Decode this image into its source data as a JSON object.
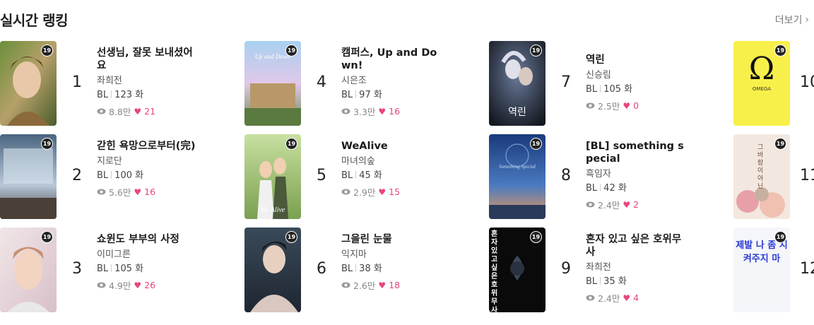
{
  "header": {
    "title": "실시간 랭킹",
    "more_label": "더보기"
  },
  "age_badge": "19",
  "ranking": [
    {
      "rank": "1",
      "title": "선생님, 잘못 보내셨어요",
      "author": "좌희전",
      "genre": "BL",
      "episodes": "123 화",
      "views": "8.8만",
      "likes": "21"
    },
    {
      "rank": "2",
      "title": "갇힌 욕망으로부터(完)",
      "author": "지로단",
      "genre": "BL",
      "episodes": "100 화",
      "views": "5.6만",
      "likes": "16"
    },
    {
      "rank": "3",
      "title": "쇼윈도 부부의 사정",
      "author": "이미그른",
      "genre": "BL",
      "episodes": "105 화",
      "views": "4.9만",
      "likes": "26"
    },
    {
      "rank": "4",
      "title": "캠퍼스, Up and Down!",
      "author": "시은조",
      "genre": "BL",
      "episodes": "97 화",
      "views": "3.3만",
      "likes": "16"
    },
    {
      "rank": "5",
      "title": "WeAlive",
      "author": "마녀의숲",
      "genre": "BL",
      "episodes": "45 화",
      "views": "2.9만",
      "likes": "15"
    },
    {
      "rank": "6",
      "title": "그을린 눈물",
      "author": "익지마",
      "genre": "BL",
      "episodes": "38 화",
      "views": "2.6만",
      "likes": "18"
    },
    {
      "rank": "7",
      "title": "역린",
      "author": "신승림",
      "genre": "BL",
      "episodes": "105 화",
      "views": "2.5만",
      "likes": "0"
    },
    {
      "rank": "8",
      "title": "[BL] something special",
      "author": "흑임자",
      "genre": "BL",
      "episodes": "42 화",
      "views": "2.4만",
      "likes": "2"
    },
    {
      "rank": "9",
      "title": "혼자 있고 싶은 호위무사",
      "author": "좌희전",
      "genre": "BL",
      "episodes": "35 화",
      "views": "2.4만",
      "likes": "4"
    },
    {
      "rank": "10"
    },
    {
      "rank": "11"
    },
    {
      "rank": "12"
    }
  ],
  "cover_texts": {
    "omega_symbol": "Ω",
    "omega_label": "OMEGA",
    "cover4_text": "Up and Down",
    "cover5_text": "We Alive",
    "cover7_text": "역린",
    "cover8_text": "Something Special",
    "cover9_text": "혼자있고싶은호위무사",
    "cover11_text": "그바람이아닌",
    "cover12_text": "제발 나 좀 지켜주지 마"
  },
  "colors": {
    "accent_heart": "#e8457b",
    "badge_bg": "#222222"
  }
}
